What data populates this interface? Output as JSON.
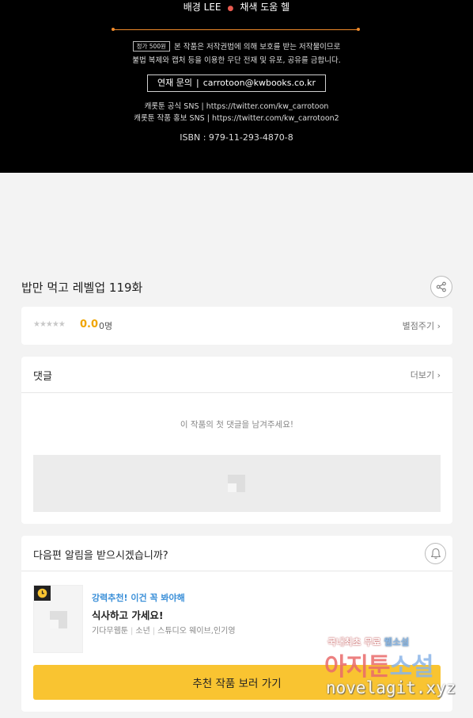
{
  "hero": {
    "credit_bg": "배경 LEE",
    "credit_color": "채색 도움 헬",
    "price_tag": "정가 500원",
    "notice_line1": "본 작품은 저작권법에 의해 보호를 받는 저작물이므로",
    "notice_line2": "불법 복제와 캡처 등을 이용한 무단 전재 및 유포, 공유를 금합니다.",
    "contact_label": "연재 문의",
    "contact_email": "carrotoon@kwbooks.co.kr",
    "sns_official": "캐롯툰 공식 SNS | https://twitter.com/kw_carrotoon",
    "sns_promo": "캐롯툰 작품 홍보 SNS | https://twitter.com/kw_carrotoon2",
    "isbn": "ISBN : 979-11-293-4870-8"
  },
  "episode": {
    "title": "밥만 먹고 레벨업 119화"
  },
  "rating": {
    "stars": "★★★★★",
    "value": "0.0",
    "count": "0명",
    "action": "별점주기 ›"
  },
  "comments": {
    "label": "댓글",
    "more": "더보기 ›",
    "empty": "이 작품의 첫 댓글을 남겨주세요!"
  },
  "notify": {
    "question": "다음편 알림을 받으시겠습니까?",
    "rec_tag": "강력추천! 이건 꼭 봐야해",
    "rec_title": "식사하고 가세요!",
    "rec_genre": "기다무웹툰",
    "rec_sub": "소년",
    "rec_author": "스튜디오 웨이브,인기영",
    "cta": "추천 작품 보러 가기"
  },
  "watermark": {
    "line1_a": "국내최초 무료",
    "line1_b": "웹소설",
    "line2_a": "아지툰",
    "line2_b": "소설",
    "line3": "novelagit.xyz"
  },
  "colors": {
    "accent_yellow": "#f9c431",
    "rating_orange": "#f0a500",
    "rec_blue": "#3a8fd8",
    "hero_bg": "#000000"
  }
}
